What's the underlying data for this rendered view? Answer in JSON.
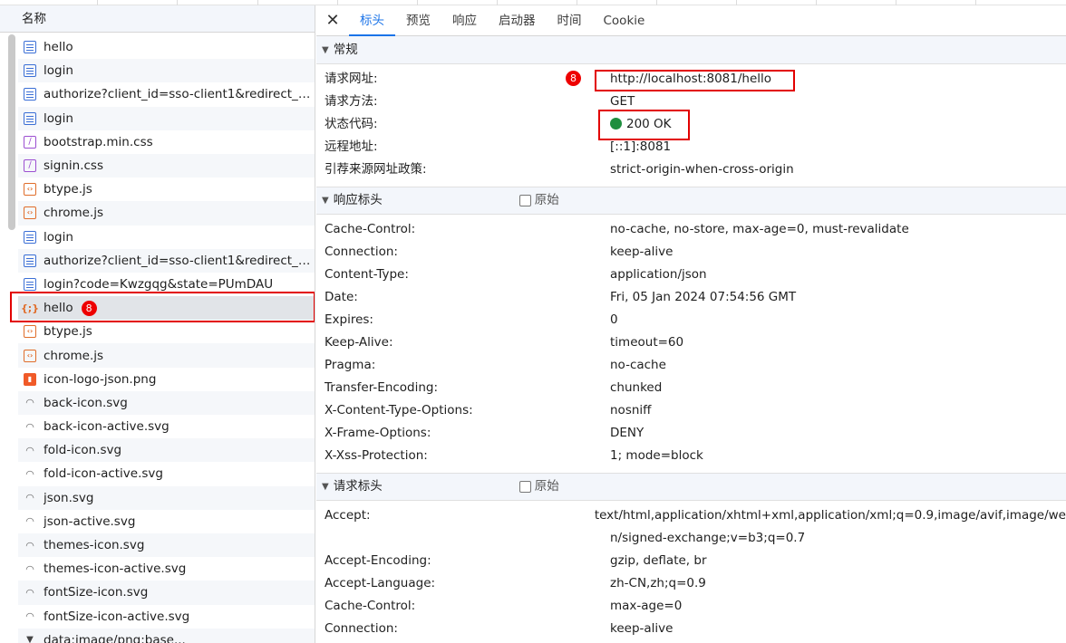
{
  "list_header": "名称",
  "requests": [
    {
      "name": "hello",
      "icon": "document-icon",
      "type": "doc"
    },
    {
      "name": "login",
      "icon": "document-icon",
      "type": "doc"
    },
    {
      "name": "authorize?client_id=sso-client1&redirect_u...",
      "icon": "document-icon",
      "type": "doc"
    },
    {
      "name": "login",
      "icon": "document-icon",
      "type": "doc"
    },
    {
      "name": "bootstrap.min.css",
      "icon": "stylesheet-icon",
      "type": "css"
    },
    {
      "name": "signin.css",
      "icon": "stylesheet-icon",
      "type": "css"
    },
    {
      "name": "btype.js",
      "icon": "script-icon",
      "type": "js"
    },
    {
      "name": "chrome.js",
      "icon": "script-icon",
      "type": "js"
    },
    {
      "name": "login",
      "icon": "document-icon",
      "type": "doc"
    },
    {
      "name": "authorize?client_id=sso-client1&redirect_u...",
      "icon": "document-icon",
      "type": "doc"
    },
    {
      "name": "login?code=Kwzgqg&state=PUmDAU",
      "icon": "document-icon",
      "type": "doc"
    },
    {
      "name": "hello",
      "icon": "json-icon",
      "type": "json",
      "selected": true,
      "badge": "8"
    },
    {
      "name": "btype.js",
      "icon": "script-icon",
      "type": "js"
    },
    {
      "name": "chrome.js",
      "icon": "script-icon",
      "type": "js"
    },
    {
      "name": "icon-logo-json.png",
      "icon": "image-icon",
      "type": "png"
    },
    {
      "name": "back-icon.svg",
      "icon": "svg-image-icon",
      "type": "svg"
    },
    {
      "name": "back-icon-active.svg",
      "icon": "svg-image-icon",
      "type": "svg"
    },
    {
      "name": "fold-icon.svg",
      "icon": "svg-image-icon",
      "type": "svg"
    },
    {
      "name": "fold-icon-active.svg",
      "icon": "svg-image-icon",
      "type": "svg"
    },
    {
      "name": "json.svg",
      "icon": "svg-image-icon",
      "type": "svg"
    },
    {
      "name": "json-active.svg",
      "icon": "svg-image-icon",
      "type": "svg"
    },
    {
      "name": "themes-icon.svg",
      "icon": "svg-image-icon",
      "type": "svg"
    },
    {
      "name": "themes-icon-active.svg",
      "icon": "svg-image-icon",
      "type": "svg"
    },
    {
      "name": "fontSize-icon.svg",
      "icon": "svg-image-icon",
      "type": "svg"
    },
    {
      "name": "fontSize-icon-active.svg",
      "icon": "svg-image-icon",
      "type": "svg"
    },
    {
      "name": "data:image/png;base...",
      "icon": "data-uri-icon",
      "type": "data"
    }
  ],
  "tabs": [
    {
      "label": "标头",
      "active": true
    },
    {
      "label": "预览"
    },
    {
      "label": "响应"
    },
    {
      "label": "启动器"
    },
    {
      "label": "时间"
    },
    {
      "label": "Cookie"
    }
  ],
  "general": {
    "title": "常规",
    "badge": "8",
    "rows": [
      {
        "key": "请求网址:",
        "value": "http://localhost:8081/hello"
      },
      {
        "key": "请求方法:",
        "value": "GET"
      },
      {
        "key": "状态代码:",
        "value": "200 OK",
        "status": true
      },
      {
        "key": "远程地址:",
        "value": "[::1]:8081"
      },
      {
        "key": "引荐来源网址政策:",
        "value": "strict-origin-when-cross-origin"
      }
    ]
  },
  "response_headers": {
    "title": "响应标头",
    "raw_label": "原始",
    "rows": [
      {
        "key": "Cache-Control:",
        "value": "no-cache, no-store, max-age=0, must-revalidate"
      },
      {
        "key": "Connection:",
        "value": "keep-alive"
      },
      {
        "key": "Content-Type:",
        "value": "application/json"
      },
      {
        "key": "Date:",
        "value": "Fri, 05 Jan 2024 07:54:56 GMT"
      },
      {
        "key": "Expires:",
        "value": "0"
      },
      {
        "key": "Keep-Alive:",
        "value": "timeout=60"
      },
      {
        "key": "Pragma:",
        "value": "no-cache"
      },
      {
        "key": "Transfer-Encoding:",
        "value": "chunked"
      },
      {
        "key": "X-Content-Type-Options:",
        "value": "nosniff"
      },
      {
        "key": "X-Frame-Options:",
        "value": "DENY"
      },
      {
        "key": "X-Xss-Protection:",
        "value": "1; mode=block"
      }
    ]
  },
  "request_headers": {
    "title": "请求标头",
    "raw_label": "原始",
    "rows": [
      {
        "key": "Accept:",
        "value": "text/html,application/xhtml+xml,application/xml;q=0.9,image/avif,image/we"
      },
      {
        "key": "",
        "value": "n/signed-exchange;v=b3;q=0.7"
      },
      {
        "key": "Accept-Encoding:",
        "value": "gzip, deflate, br"
      },
      {
        "key": "Accept-Language:",
        "value": "zh-CN,zh;q=0.9"
      },
      {
        "key": "Cache-Control:",
        "value": "max-age=0"
      },
      {
        "key": "Connection:",
        "value": "keep-alive"
      }
    ]
  },
  "colors": {
    "accent": "#1a73e8",
    "highlight": "#e20000",
    "status_ok": "#1e8e3e"
  }
}
